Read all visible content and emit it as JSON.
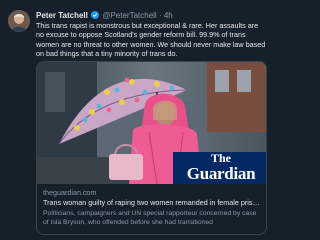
{
  "tweet": {
    "author_name": "Peter Tatchell",
    "verified_icon": "verified-badge-icon",
    "handle": "@PeterTatchell",
    "dot": "·",
    "time": "4h",
    "text": "This trans rapist is monstrous but exceptional & rare. Her assaults are no excuse to oppose Scotland's gender reform bill. 99.9% of trans women are no threat to other women. We should never make law based on bad things that a tiny minority of trans do."
  },
  "card": {
    "image_alt": "woman-with-umbrella-photo",
    "logo_the": "The",
    "logo_guardian": "Guardian",
    "domain": "theguardian.com",
    "title": "Trans woman guilty of raping two women remanded in female prison…",
    "description": "Politicians, campaigners and UN special rapporteur concerned by case of Isla Bryson, who offended before she had transitioned"
  },
  "colors": {
    "background": "#15202b",
    "text": "#e7e9ea",
    "secondary": "#8b98a5",
    "border": "#38444d",
    "verified": "#1d9bf0",
    "guardian_blue": "#052962"
  }
}
